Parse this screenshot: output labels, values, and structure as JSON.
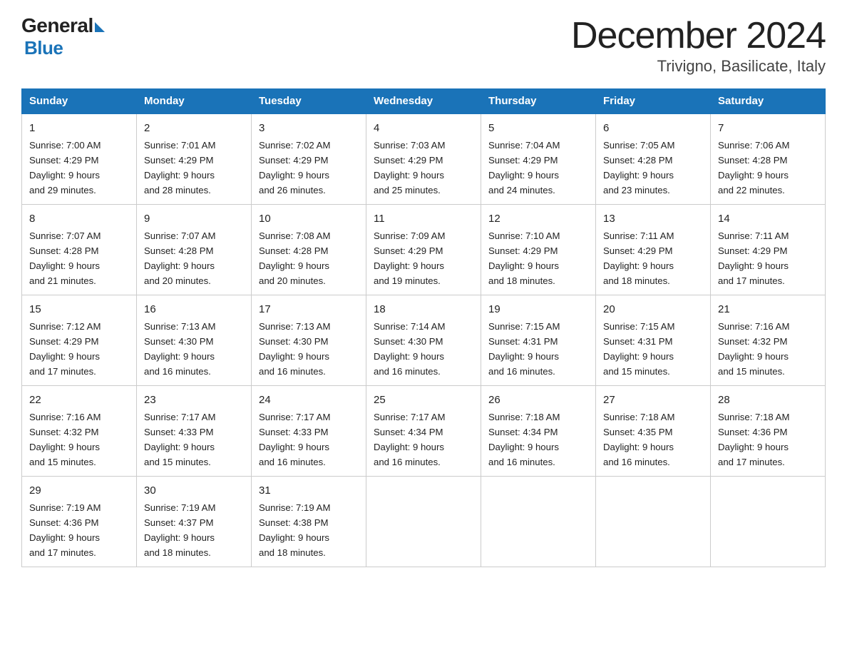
{
  "logo": {
    "text_general": "General",
    "text_blue": "Blue"
  },
  "title": "December 2024",
  "subtitle": "Trivigno, Basilicate, Italy",
  "days_of_week": [
    "Sunday",
    "Monday",
    "Tuesday",
    "Wednesday",
    "Thursday",
    "Friday",
    "Saturday"
  ],
  "weeks": [
    [
      {
        "day": "1",
        "info": "Sunrise: 7:00 AM\nSunset: 4:29 PM\nDaylight: 9 hours\nand 29 minutes."
      },
      {
        "day": "2",
        "info": "Sunrise: 7:01 AM\nSunset: 4:29 PM\nDaylight: 9 hours\nand 28 minutes."
      },
      {
        "day": "3",
        "info": "Sunrise: 7:02 AM\nSunset: 4:29 PM\nDaylight: 9 hours\nand 26 minutes."
      },
      {
        "day": "4",
        "info": "Sunrise: 7:03 AM\nSunset: 4:29 PM\nDaylight: 9 hours\nand 25 minutes."
      },
      {
        "day": "5",
        "info": "Sunrise: 7:04 AM\nSunset: 4:29 PM\nDaylight: 9 hours\nand 24 minutes."
      },
      {
        "day": "6",
        "info": "Sunrise: 7:05 AM\nSunset: 4:28 PM\nDaylight: 9 hours\nand 23 minutes."
      },
      {
        "day": "7",
        "info": "Sunrise: 7:06 AM\nSunset: 4:28 PM\nDaylight: 9 hours\nand 22 minutes."
      }
    ],
    [
      {
        "day": "8",
        "info": "Sunrise: 7:07 AM\nSunset: 4:28 PM\nDaylight: 9 hours\nand 21 minutes."
      },
      {
        "day": "9",
        "info": "Sunrise: 7:07 AM\nSunset: 4:28 PM\nDaylight: 9 hours\nand 20 minutes."
      },
      {
        "day": "10",
        "info": "Sunrise: 7:08 AM\nSunset: 4:28 PM\nDaylight: 9 hours\nand 20 minutes."
      },
      {
        "day": "11",
        "info": "Sunrise: 7:09 AM\nSunset: 4:29 PM\nDaylight: 9 hours\nand 19 minutes."
      },
      {
        "day": "12",
        "info": "Sunrise: 7:10 AM\nSunset: 4:29 PM\nDaylight: 9 hours\nand 18 minutes."
      },
      {
        "day": "13",
        "info": "Sunrise: 7:11 AM\nSunset: 4:29 PM\nDaylight: 9 hours\nand 18 minutes."
      },
      {
        "day": "14",
        "info": "Sunrise: 7:11 AM\nSunset: 4:29 PM\nDaylight: 9 hours\nand 17 minutes."
      }
    ],
    [
      {
        "day": "15",
        "info": "Sunrise: 7:12 AM\nSunset: 4:29 PM\nDaylight: 9 hours\nand 17 minutes."
      },
      {
        "day": "16",
        "info": "Sunrise: 7:13 AM\nSunset: 4:30 PM\nDaylight: 9 hours\nand 16 minutes."
      },
      {
        "day": "17",
        "info": "Sunrise: 7:13 AM\nSunset: 4:30 PM\nDaylight: 9 hours\nand 16 minutes."
      },
      {
        "day": "18",
        "info": "Sunrise: 7:14 AM\nSunset: 4:30 PM\nDaylight: 9 hours\nand 16 minutes."
      },
      {
        "day": "19",
        "info": "Sunrise: 7:15 AM\nSunset: 4:31 PM\nDaylight: 9 hours\nand 16 minutes."
      },
      {
        "day": "20",
        "info": "Sunrise: 7:15 AM\nSunset: 4:31 PM\nDaylight: 9 hours\nand 15 minutes."
      },
      {
        "day": "21",
        "info": "Sunrise: 7:16 AM\nSunset: 4:32 PM\nDaylight: 9 hours\nand 15 minutes."
      }
    ],
    [
      {
        "day": "22",
        "info": "Sunrise: 7:16 AM\nSunset: 4:32 PM\nDaylight: 9 hours\nand 15 minutes."
      },
      {
        "day": "23",
        "info": "Sunrise: 7:17 AM\nSunset: 4:33 PM\nDaylight: 9 hours\nand 15 minutes."
      },
      {
        "day": "24",
        "info": "Sunrise: 7:17 AM\nSunset: 4:33 PM\nDaylight: 9 hours\nand 16 minutes."
      },
      {
        "day": "25",
        "info": "Sunrise: 7:17 AM\nSunset: 4:34 PM\nDaylight: 9 hours\nand 16 minutes."
      },
      {
        "day": "26",
        "info": "Sunrise: 7:18 AM\nSunset: 4:34 PM\nDaylight: 9 hours\nand 16 minutes."
      },
      {
        "day": "27",
        "info": "Sunrise: 7:18 AM\nSunset: 4:35 PM\nDaylight: 9 hours\nand 16 minutes."
      },
      {
        "day": "28",
        "info": "Sunrise: 7:18 AM\nSunset: 4:36 PM\nDaylight: 9 hours\nand 17 minutes."
      }
    ],
    [
      {
        "day": "29",
        "info": "Sunrise: 7:19 AM\nSunset: 4:36 PM\nDaylight: 9 hours\nand 17 minutes."
      },
      {
        "day": "30",
        "info": "Sunrise: 7:19 AM\nSunset: 4:37 PM\nDaylight: 9 hours\nand 18 minutes."
      },
      {
        "day": "31",
        "info": "Sunrise: 7:19 AM\nSunset: 4:38 PM\nDaylight: 9 hours\nand 18 minutes."
      },
      {
        "day": "",
        "info": ""
      },
      {
        "day": "",
        "info": ""
      },
      {
        "day": "",
        "info": ""
      },
      {
        "day": "",
        "info": ""
      }
    ]
  ]
}
